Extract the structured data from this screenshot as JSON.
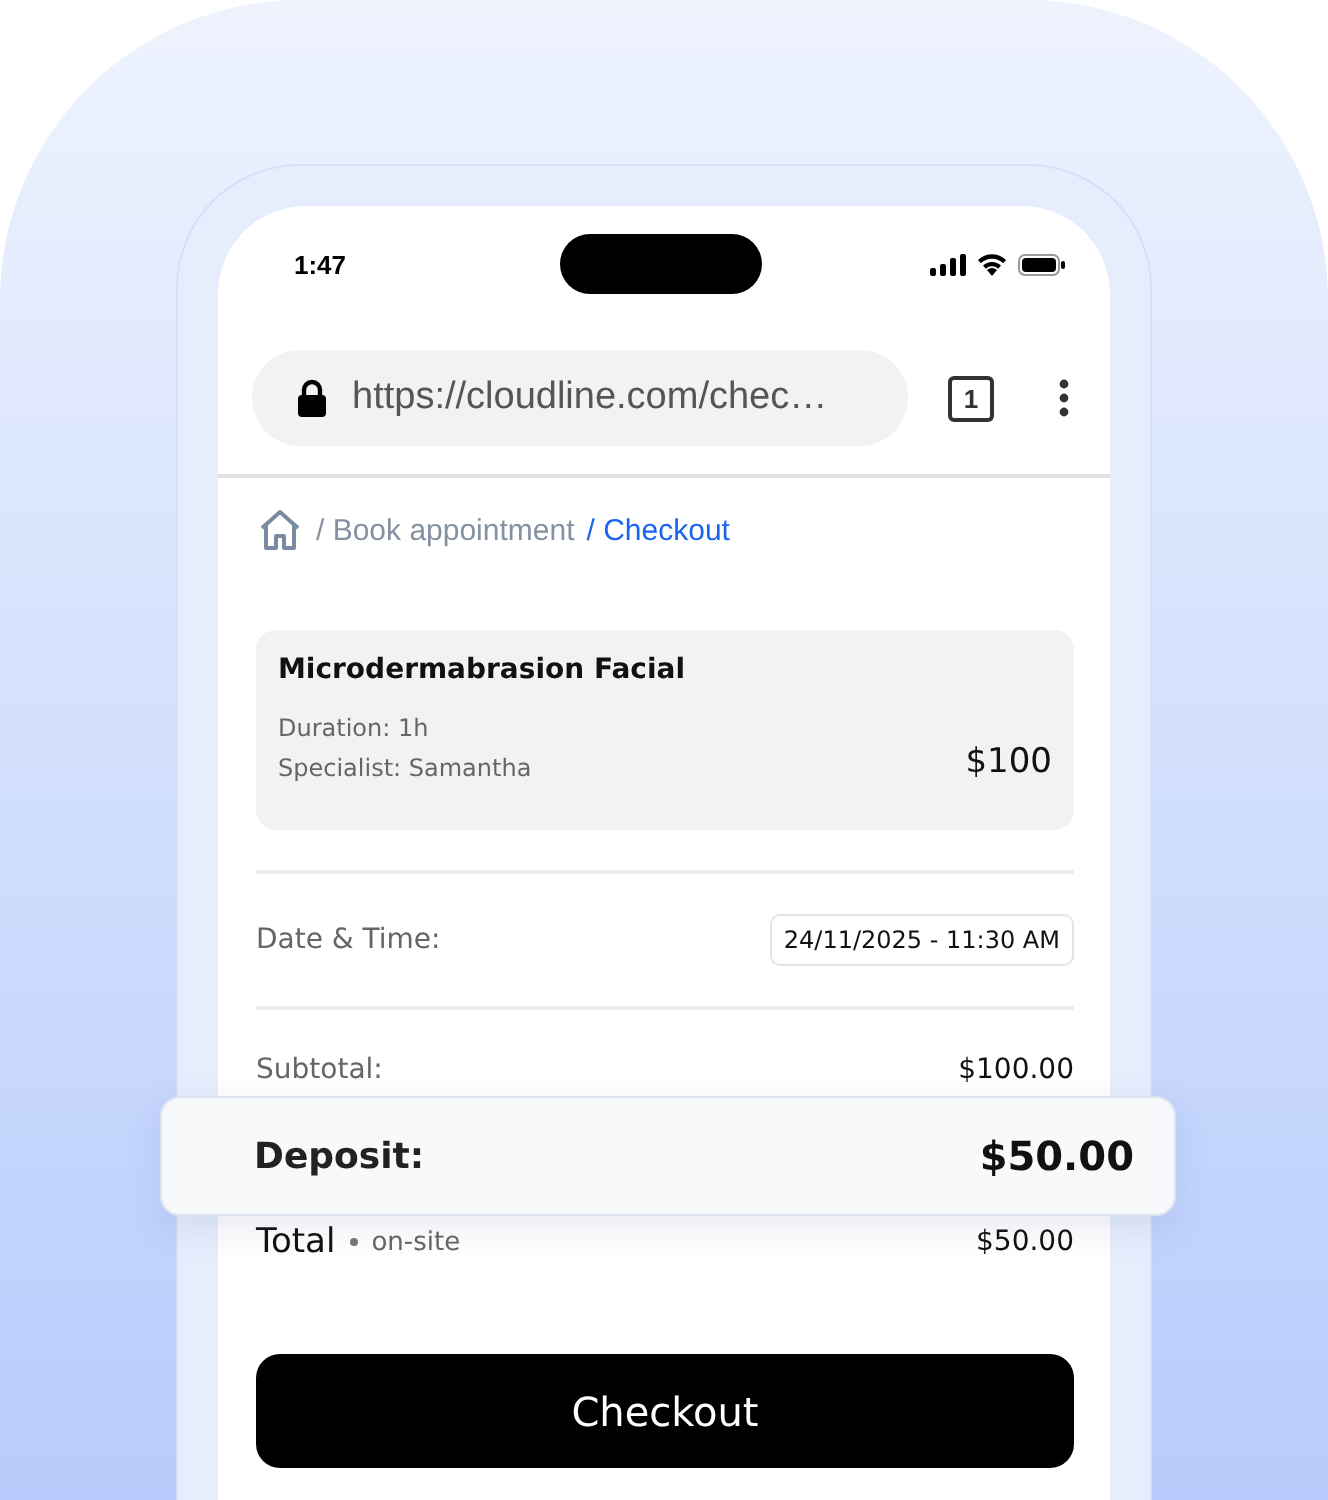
{
  "status_bar": {
    "time": "1:47"
  },
  "browser": {
    "url": "https://cloudline.com/chec…",
    "tab_count": "1"
  },
  "breadcrumb": [
    {
      "label": "/ Book appointment",
      "selected": false
    },
    {
      "label": "/ Checkout",
      "selected": true
    }
  ],
  "service": {
    "name": "Microdermabrasion Facial",
    "duration": "Duration: 1h",
    "specialist": "Specialist: Samantha",
    "price": "$100"
  },
  "date_time": {
    "label": "Date & Time:",
    "value": "24/11/2025 - 11:30 AM"
  },
  "subtotal": {
    "label": "Subtotal:",
    "value": "$100.00"
  },
  "deposit": {
    "label": "Deposit:",
    "value": "$50.00"
  },
  "total": {
    "label": "Total",
    "note": "on-site",
    "value": "$50.00"
  },
  "checkout_button": "Checkout"
}
